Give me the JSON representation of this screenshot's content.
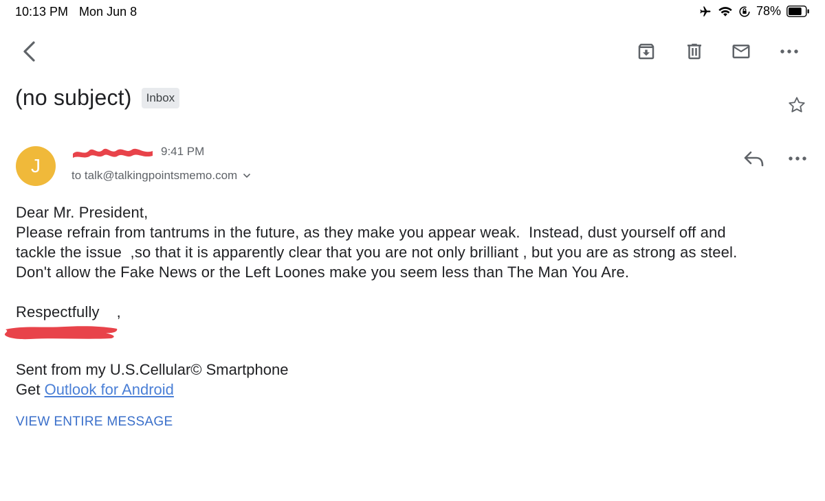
{
  "status_bar": {
    "time": "10:13 PM",
    "date": "Mon Jun 8",
    "battery_percent": "78%",
    "battery_level": 0.78,
    "icons": [
      "airplane-icon",
      "wifi-icon",
      "rotation-lock-icon",
      "battery-icon"
    ]
  },
  "toolbar": {
    "icons": [
      "back-arrow-icon",
      "archive-icon",
      "trash-icon",
      "mark-unread-icon",
      "more-horizontal-icon"
    ]
  },
  "message": {
    "subject": "(no subject)",
    "label": "Inbox",
    "avatar_initial": "J",
    "avatar_color": "#f0b93a",
    "time": "9:41 PM",
    "to_line": "to talk@talkingpointsmemo.com",
    "body": {
      "greeting": "Dear Mr. President,",
      "lines": [
        "Please refrain from tantrums in the future, as they make you appear weak.  Instead, dust yourself off and",
        "tackle the issue  ,so that it is apparently clear that you are not only brilliant , but you are as strong as steel.",
        "Don't allow the Fake News or the Left Loones make you seem less than The Man You Are."
      ],
      "closing": "Respectfully    ,"
    },
    "signature": {
      "sent_from": "Sent from my U.S.Cellular© Smartphone",
      "get_prefix": "Get ",
      "get_link": "Outlook for Android"
    },
    "view_entire": "VIEW ENTIRE MESSAGE"
  },
  "colors": {
    "accent": "#3a6fca",
    "link": "#4a7fd6",
    "redaction": "#e8434a",
    "icon_gray": "#5f6368"
  }
}
